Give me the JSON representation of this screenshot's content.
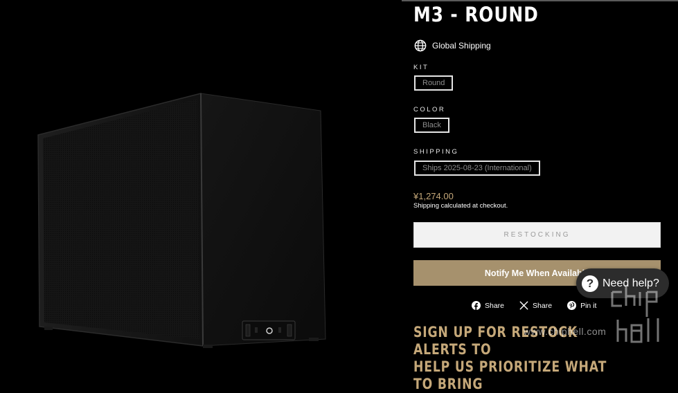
{
  "product": {
    "title": "M3 - ROUND",
    "global_shipping": "Global Shipping",
    "options": [
      {
        "label": "KIT",
        "value": "Round"
      },
      {
        "label": "COLOR",
        "value": "Black"
      },
      {
        "label": "SHIPPING",
        "value": "Ships 2025-08-23 (International)"
      }
    ],
    "price": "¥1,274.00",
    "shipping_note_link": "Shipping",
    "shipping_note_rest": " calculated at checkout."
  },
  "buttons": {
    "restocking": "RESTOCKING",
    "notify": "Notify Me When Available"
  },
  "share": {
    "facebook": "Share",
    "x": "Share",
    "pinterest": "Pin it"
  },
  "signup": {
    "line1": "SIGN UP FOR RESTOCK ALERTS TO",
    "line2": "HELP US PRIORITIZE WHAT TO BRING"
  },
  "chat": {
    "label": "Need help?",
    "icon": "question-icon"
  },
  "watermark": {
    "text": "www.chiphell.com",
    "logo_text": "chip hell"
  },
  "colors": {
    "background": "#000000",
    "accent_gold": "#c5a879",
    "notify_button": "#a6916d",
    "restock_button": "#f2f2f2"
  },
  "icons": [
    "globe-icon",
    "facebook-icon",
    "x-icon",
    "pinterest-icon",
    "question-icon"
  ]
}
